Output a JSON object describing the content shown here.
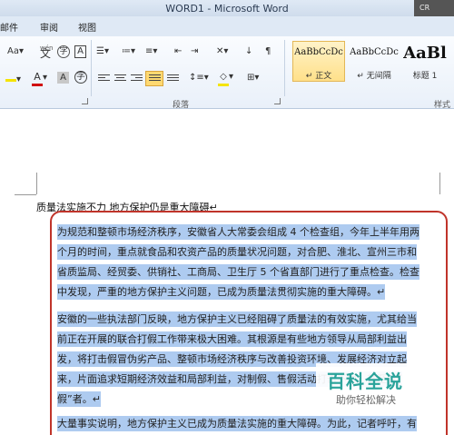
{
  "window": {
    "title": "WORD1 - Microsoft Word",
    "corner_label": "CR"
  },
  "tabs": [
    {
      "label": "邮件"
    },
    {
      "label": "审阅"
    },
    {
      "label": "视图"
    }
  ],
  "ribbon": {
    "font_glyphs": {
      "size_label": "Aa",
      "pinyin": "wén",
      "border_char": "A"
    },
    "paragraph_group_label": "段落",
    "styles_group_label": "样式",
    "styles": [
      {
        "sample": "AaBbCcDc",
        "name": "↵ 正文",
        "active": true
      },
      {
        "sample": "AaBbCcDc",
        "name": "↵ 无间隔",
        "active": false
      },
      {
        "sample": "AaBl",
        "name": "标题 1",
        "active": false
      }
    ]
  },
  "document": {
    "title_line": "质量法实施不力  地方保护仍是重大障碍↵",
    "paragraphs": [
      "为规范和整顿市场经济秩序，安徽省人大常委会组成 4 个检查组，今年上半年用两个月的时间，重点就食品和农资产品的质量状况问题，对合肥、淮北、宣州三市和省质监局、经贸委、供销社、工商局、卫生厅 5 个省直部门进行了重点检查。检查中发现，严重的地方保护主义问题，已成为质量法贯彻实施的重大障碍。↵",
      "安徽的一些执法部门反映，地方保护主义已经阻碍了质量法的有效实施，尤其给当前正在开展的联合打假工作带来极大困难。其根源是有些地方领导从局部利益出发，将打击假冒伪劣产品、整顿市场经济秩序与改善投资环境、发展经济对立起来，片面追求短期经济效益和局部利益，对制假、售假活动打击不力，甚至“打假”者。↵",
      "大量事实说明，地方保护主义已成为质量法实施的重大障碍。为此，记者呼吁，有"
    ]
  },
  "watermark": {
    "brand": "百科全说",
    "slogan": "助你轻松解决"
  },
  "colors": {
    "selection": "#aecbf0",
    "annotation_border": "#c0342a",
    "active_style": "#ffe08a",
    "watermark": "#2aa39a"
  }
}
